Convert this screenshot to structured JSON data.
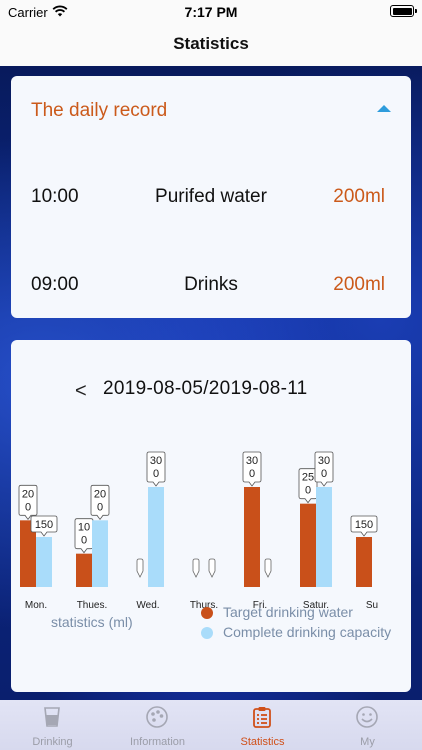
{
  "status_bar": {
    "carrier": "Carrier",
    "time": "7:17 PM"
  },
  "nav": {
    "title": "Statistics"
  },
  "daily_record": {
    "title": "The daily record",
    "rows": [
      {
        "time": "10:00",
        "type": "Purifed water",
        "amount": "200ml"
      },
      {
        "time": "09:00",
        "type": "Drinks",
        "amount": "200ml"
      }
    ]
  },
  "statistics": {
    "date_range": "2019-08-05/2019-08-11",
    "prev_symbol": "<",
    "y_label": "statistics (ml)",
    "legend": {
      "target": "Target drinking water",
      "complete": "Complete drinking capacity"
    },
    "colors": {
      "target": "#c9501a",
      "complete": "#a9dcfa",
      "accent": "#cb5a1b"
    }
  },
  "chart_data": {
    "type": "bar",
    "categories": [
      "Mon.",
      "Thues.",
      "Wed.",
      "Thurs.",
      "Fri.",
      "Satur.",
      "Su"
    ],
    "series": [
      {
        "name": "Target drinking water",
        "values": [
          200,
          100,
          0,
          0,
          300,
          250,
          150
        ]
      },
      {
        "name": "Complete drinking capacity",
        "values": [
          150,
          200,
          300,
          0,
          0,
          300,
          null
        ]
      }
    ],
    "value_labels": [
      [
        "20\n0",
        "150"
      ],
      [
        "10\n0",
        "20\n0"
      ],
      [
        "",
        "30\n0"
      ],
      [
        "",
        ""
      ],
      [
        "30\n0",
        ""
      ],
      [
        "25\n0",
        "30\n0"
      ],
      [
        "150",
        ""
      ]
    ],
    "ylabel": "statistics (ml)",
    "ylim": [
      0,
      300
    ]
  },
  "tabs": [
    {
      "label": "Drinking",
      "icon": "cup-icon",
      "active": false
    },
    {
      "label": "Information",
      "icon": "palette-icon",
      "active": false
    },
    {
      "label": "Statistics",
      "icon": "clipboard-icon",
      "active": true
    },
    {
      "label": "My",
      "icon": "smiley-icon",
      "active": false
    }
  ]
}
